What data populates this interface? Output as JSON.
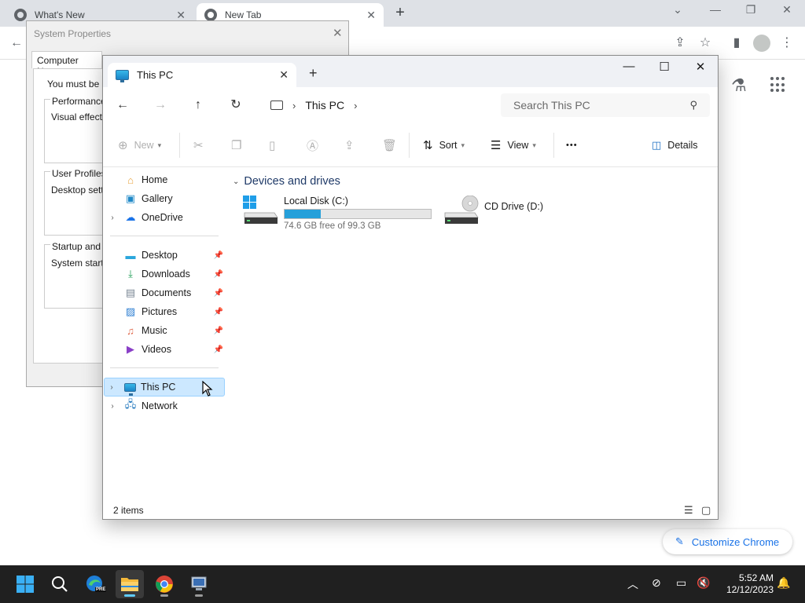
{
  "browser": {
    "tabs": [
      {
        "title": "What's New"
      },
      {
        "title": "New Tab"
      }
    ],
    "customize_label": "Customize Chrome"
  },
  "system_properties": {
    "title": "System Properties",
    "active_tab": "Computer Name",
    "intro_text": "You must be lo",
    "performance": {
      "label": "Performance",
      "text": "Visual effects,"
    },
    "user_profiles": {
      "label": "User Profiles",
      "text": "Desktop settin"
    },
    "startup": {
      "label": "Startup and R",
      "text": "System startup"
    }
  },
  "explorer": {
    "tab_title": "This PC",
    "address": {
      "crumbs": [
        "This PC"
      ]
    },
    "search_placeholder": "Search This PC",
    "commands": {
      "new": "New",
      "sort": "Sort",
      "view": "View",
      "more": "•••",
      "details": "Details"
    },
    "nav": {
      "top": [
        {
          "label": "Home",
          "icon": "home-icon"
        },
        {
          "label": "Gallery",
          "icon": "gallery-icon"
        },
        {
          "label": "OneDrive",
          "icon": "onedrive-icon"
        }
      ],
      "pinned": [
        {
          "label": "Desktop",
          "icon": "desktop-icon"
        },
        {
          "label": "Downloads",
          "icon": "downloads-icon"
        },
        {
          "label": "Documents",
          "icon": "documents-icon"
        },
        {
          "label": "Pictures",
          "icon": "pictures-icon"
        },
        {
          "label": "Music",
          "icon": "music-icon"
        },
        {
          "label": "Videos",
          "icon": "videos-icon"
        }
      ],
      "bottom": [
        {
          "label": "This PC",
          "icon": "this-pc-icon",
          "selected": true
        },
        {
          "label": "Network",
          "icon": "network-icon"
        }
      ]
    },
    "group_title": "Devices and drives",
    "drives": [
      {
        "name": "Local Disk (C:)",
        "free_text": "74.6 GB free of 99.3 GB",
        "used_fraction": 0.249
      },
      {
        "name": "CD Drive (D:)"
      }
    ],
    "status": "2 items"
  },
  "taskbar": {
    "time": "5:52 AM",
    "date": "12/12/2023",
    "edge_badge": "PRE"
  },
  "colors": {
    "accent": "#26a0da",
    "selection": "#cce8ff",
    "taskbar": "#202020",
    "chrome_link": "#1a73e8"
  }
}
